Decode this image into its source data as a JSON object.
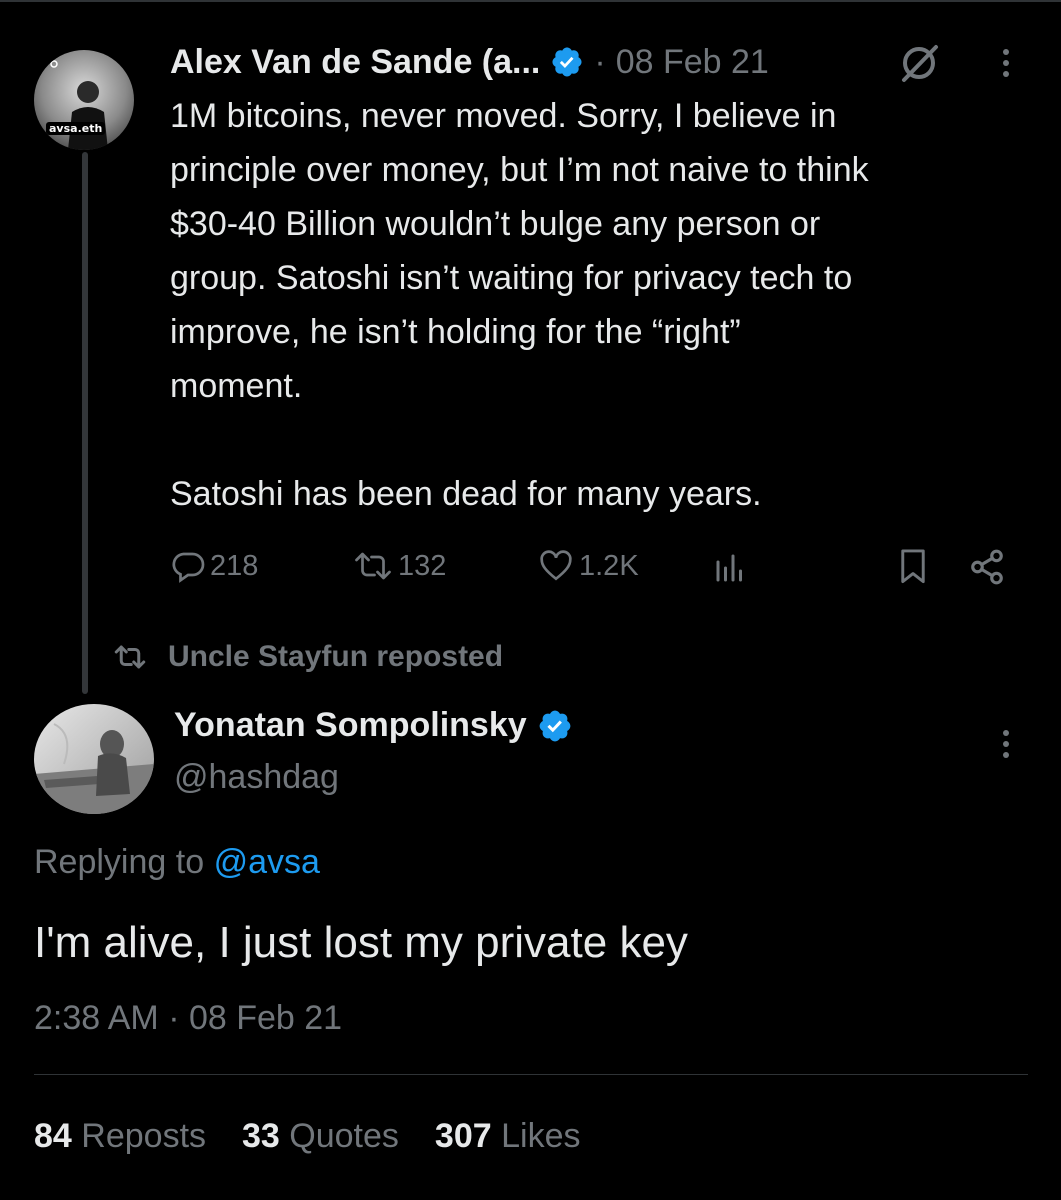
{
  "quoted_tweet": {
    "author_name": "Alex Van de Sande (a...",
    "separator": "·",
    "date": "08 Feb 21",
    "avatar_label": "avsa.eth",
    "text": "1M bitcoins, never moved. Sorry, I believe in\nprinciple over money, but I’m not naive to think\n$30-40 Billion wouldn’t bulge any person or\ngroup. Satoshi isn’t waiting for privacy tech to\nimprove, he isn’t holding for the “right”\nmoment.\n\nSatoshi has been dead for many years.",
    "actions": {
      "replies": "218",
      "reposts": "132",
      "likes": "1.2K"
    }
  },
  "repost_banner": {
    "text": "Uncle Stayfun reposted"
  },
  "main_tweet": {
    "author_name": "Yonatan Sompolinsky",
    "handle": "@hashdag",
    "replying_prefix": "Replying to",
    "replying_handle": "@avsa",
    "text": "I'm alive, I just lost my private key",
    "timestamp": "2:38 AM · 08 Feb 21"
  },
  "stats": {
    "reposts_count": "84",
    "reposts_label": "Reposts",
    "quotes_count": "33",
    "quotes_label": "Quotes",
    "likes_count": "307",
    "likes_label": "Likes"
  },
  "colors": {
    "background": "#000000",
    "text": "#e7e9ea",
    "muted": "#71767b",
    "accent": "#1d9bf0",
    "divider": "#2f3336"
  },
  "icons": {
    "verified": "verified-badge-icon",
    "grok": "grok-icon",
    "more": "more-vertical-icon",
    "reply": "reply-icon",
    "repost": "repost-icon",
    "like": "heart-icon",
    "views": "analytics-icon",
    "bookmark": "bookmark-icon",
    "share": "share-icon"
  }
}
